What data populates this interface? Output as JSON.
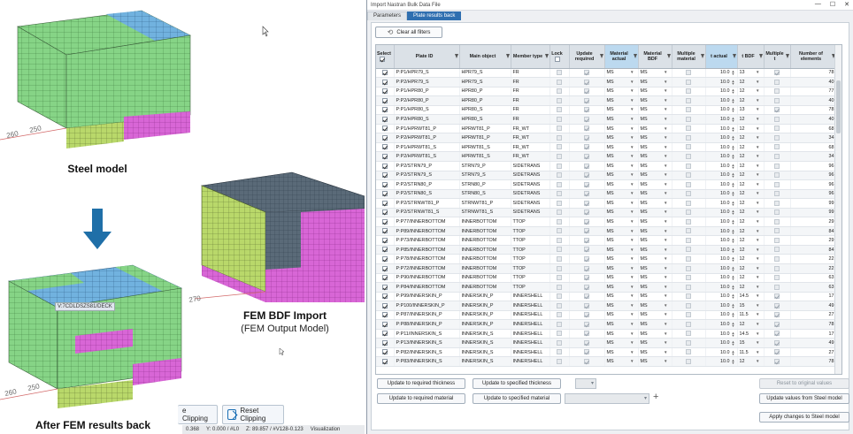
{
  "left": {
    "captions": {
      "steel": "Steel model",
      "after": "After FEM results back",
      "fem_title": "FEM BDF Import",
      "fem_sub": "(FEM Output Model)"
    },
    "tag_label": "V:7CDLDSZS81/DECK",
    "axis_ticks": [
      "260",
      "250",
      "270",
      "260",
      "250"
    ],
    "clip_button_partial": "e Clipping",
    "reset_clipping": "Reset Clipping",
    "status": [
      "0.368",
      "Y:  0.000 / #L0",
      "Z:  89.857 / #V128-0.123",
      "Visualization"
    ]
  },
  "dialog": {
    "title": "Import Nastran Bulk Data File",
    "tabs": [
      "Parameters",
      "Plate results back"
    ],
    "active_tab": 1,
    "clear_filters": "Clear all filters",
    "columns": [
      "Select",
      "Plate ID",
      "Main object",
      "Member type",
      "Lock",
      "Update required",
      "Material actual",
      "Material BDF",
      "Multiple material",
      "t actual",
      "t BDF",
      "Multiple t",
      "Number of elements"
    ],
    "rows": [
      {
        "id": "P:P1/HPR79_S",
        "main": "HPR79_S",
        "type": "FR",
        "upd": true,
        "mat": "MS",
        "matb": "MS",
        "t": "10.0",
        "tb": "13",
        "mt": true,
        "n": "78"
      },
      {
        "id": "P:P2/HPR79_S",
        "main": "HPR79_S",
        "type": "FR",
        "upd": true,
        "mat": "MS",
        "matb": "MS",
        "t": "10.0",
        "tb": "12",
        "mt": false,
        "n": "40"
      },
      {
        "id": "P:P1/HPR80_P",
        "main": "HPR80_P",
        "type": "FR",
        "upd": true,
        "mat": "MS",
        "matb": "MS",
        "t": "10.0",
        "tb": "12",
        "mt": false,
        "n": "77"
      },
      {
        "id": "P:P2/HPR80_P",
        "main": "HPR80_P",
        "type": "FR",
        "upd": true,
        "mat": "MS",
        "matb": "MS",
        "t": "10.0",
        "tb": "12",
        "mt": false,
        "n": "40"
      },
      {
        "id": "P:P1/HPR80_S",
        "main": "HPR80_S",
        "type": "FR",
        "upd": true,
        "mat": "MS",
        "matb": "MS",
        "t": "10.0",
        "tb": "13",
        "mt": true,
        "n": "78"
      },
      {
        "id": "P:P2/HPR80_S",
        "main": "HPR80_S",
        "type": "FR",
        "upd": true,
        "mat": "MS",
        "matb": "MS",
        "t": "10.0",
        "tb": "12",
        "mt": false,
        "n": "40"
      },
      {
        "id": "P:P1/HPRWT81_P",
        "main": "HPRWT81_P",
        "type": "FR_WT",
        "upd": true,
        "mat": "MS",
        "matb": "MS",
        "t": "10.0",
        "tb": "12",
        "mt": false,
        "n": "68"
      },
      {
        "id": "P:P2/HPRWT81_P",
        "main": "HPRWT81_P",
        "type": "FR_WT",
        "upd": true,
        "mat": "MS",
        "matb": "MS",
        "t": "10.0",
        "tb": "12",
        "mt": false,
        "n": "34"
      },
      {
        "id": "P:P1/HPRWT81_S",
        "main": "HPRWT81_S",
        "type": "FR_WT",
        "upd": true,
        "mat": "MS",
        "matb": "MS",
        "t": "10.0",
        "tb": "12",
        "mt": false,
        "n": "68"
      },
      {
        "id": "P:P2/HPRWT81_S",
        "main": "HPRWT81_S",
        "type": "FR_WT",
        "upd": true,
        "mat": "MS",
        "matb": "MS",
        "t": "10.0",
        "tb": "12",
        "mt": false,
        "n": "34"
      },
      {
        "id": "P:P2/STRN79_P",
        "main": "STRN79_P",
        "type": "SIDETRANS",
        "upd": true,
        "mat": "MS",
        "matb": "MS",
        "t": "10.0",
        "tb": "12",
        "mt": false,
        "n": "96"
      },
      {
        "id": "P:P2/STRN79_S",
        "main": "STRN79_S",
        "type": "SIDETRANS",
        "upd": true,
        "mat": "MS",
        "matb": "MS",
        "t": "10.0",
        "tb": "12",
        "mt": false,
        "n": "96"
      },
      {
        "id": "P:P2/STRN80_P",
        "main": "STRN80_P",
        "type": "SIDETRANS",
        "upd": true,
        "mat": "MS",
        "matb": "MS",
        "t": "10.0",
        "tb": "12",
        "mt": false,
        "n": "96"
      },
      {
        "id": "P:P2/STRN80_S",
        "main": "STRN80_S",
        "type": "SIDETRANS",
        "upd": true,
        "mat": "MS",
        "matb": "MS",
        "t": "10.0",
        "tb": "12",
        "mt": false,
        "n": "96"
      },
      {
        "id": "P:P2/STRNWT81_P",
        "main": "STRNWT81_P",
        "type": "SIDETRANS",
        "upd": true,
        "mat": "MS",
        "matb": "MS",
        "t": "10.0",
        "tb": "12",
        "mt": false,
        "n": "99"
      },
      {
        "id": "P:P2/STRNWT81_S",
        "main": "STRNWT81_S",
        "type": "SIDETRANS",
        "upd": true,
        "mat": "MS",
        "matb": "MS",
        "t": "10.0",
        "tb": "12",
        "mt": false,
        "n": "99"
      },
      {
        "id": "P:P77/INNERBOTTOM",
        "main": "INNERBOTTOM",
        "type": "TTOP",
        "upd": true,
        "mat": "MS",
        "matb": "MS",
        "t": "10.0",
        "tb": "12",
        "mt": false,
        "n": "29"
      },
      {
        "id": "P:P89/INNERBOTTOM",
        "main": "INNERBOTTOM",
        "type": "TTOP",
        "upd": true,
        "mat": "MS",
        "matb": "MS",
        "t": "10.0",
        "tb": "12",
        "mt": false,
        "n": "84"
      },
      {
        "id": "P:P73/INNERBOTTOM",
        "main": "INNERBOTTOM",
        "type": "TTOP",
        "upd": true,
        "mat": "MS",
        "matb": "MS",
        "t": "10.0",
        "tb": "12",
        "mt": false,
        "n": "29"
      },
      {
        "id": "P:P85/INNERBOTTOM",
        "main": "INNERBOTTOM",
        "type": "TTOP",
        "upd": true,
        "mat": "MS",
        "matb": "MS",
        "t": "10.0",
        "tb": "12",
        "mt": false,
        "n": "84"
      },
      {
        "id": "P:P78/INNERBOTTOM",
        "main": "INNERBOTTOM",
        "type": "TTOP",
        "upd": true,
        "mat": "MS",
        "matb": "MS",
        "t": "10.0",
        "tb": "12",
        "mt": false,
        "n": "22"
      },
      {
        "id": "P:P72/INNERBOTTOM",
        "main": "INNERBOTTOM",
        "type": "TTOP",
        "upd": true,
        "mat": "MS",
        "matb": "MS",
        "t": "10.0",
        "tb": "12",
        "mt": false,
        "n": "22"
      },
      {
        "id": "P:P90/INNERBOTTOM",
        "main": "INNERBOTTOM",
        "type": "TTOP",
        "upd": true,
        "mat": "MS",
        "matb": "MS",
        "t": "10.0",
        "tb": "12",
        "mt": false,
        "n": "63"
      },
      {
        "id": "P:P84/INNERBOTTOM",
        "main": "INNERBOTTOM",
        "type": "TTOP",
        "upd": true,
        "mat": "MS",
        "matb": "MS",
        "t": "10.0",
        "tb": "12",
        "mt": false,
        "n": "63"
      },
      {
        "id": "P:P99/INNERSKIN_P",
        "main": "INNERSKIN_P",
        "type": "INNERSHELL",
        "upd": true,
        "mat": "MS",
        "matb": "MS",
        "t": "10.0",
        "tb": "14.5",
        "mt": true,
        "n": "17"
      },
      {
        "id": "P:P100/INNERSKIN_P",
        "main": "INNERSKIN_P",
        "type": "INNERSHELL",
        "upd": true,
        "mat": "MS",
        "matb": "MS",
        "t": "10.0",
        "tb": "15",
        "mt": true,
        "n": "49"
      },
      {
        "id": "P:P87/INNERSKIN_P",
        "main": "INNERSKIN_P",
        "type": "INNERSHELL",
        "upd": true,
        "mat": "MS",
        "matb": "MS",
        "t": "10.0",
        "tb": "11.5",
        "mt": true,
        "n": "27"
      },
      {
        "id": "P:P88/INNERSKIN_P",
        "main": "INNERSKIN_P",
        "type": "INNERSHELL",
        "upd": true,
        "mat": "MS",
        "matb": "MS",
        "t": "10.0",
        "tb": "12",
        "mt": true,
        "n": "78"
      },
      {
        "id": "P:P11/INNERSKIN_S",
        "main": "INNERSKIN_S",
        "type": "INNERSHELL",
        "upd": true,
        "mat": "MS",
        "matb": "MS",
        "t": "10.0",
        "tb": "14.5",
        "mt": true,
        "n": "17"
      },
      {
        "id": "P:P13/INNERSKIN_S",
        "main": "INNERSKIN_S",
        "type": "INNERSHELL",
        "upd": true,
        "mat": "MS",
        "matb": "MS",
        "t": "10.0",
        "tb": "15",
        "mt": true,
        "n": "49"
      },
      {
        "id": "P:P82/INNERSKIN_S",
        "main": "INNERSKIN_S",
        "type": "INNERSHELL",
        "upd": true,
        "mat": "MS",
        "matb": "MS",
        "t": "10.0",
        "tb": "11.5",
        "mt": true,
        "n": "27"
      },
      {
        "id": "P:P83/INNERSKIN_S",
        "main": "INNERSKIN_S",
        "type": "INNERSHELL",
        "upd": true,
        "mat": "MS",
        "matb": "MS",
        "t": "10.0",
        "tb": "12",
        "mt": true,
        "n": "78"
      }
    ],
    "buttons": {
      "upd_req_thk": "Update to required thickness",
      "upd_spec_thk": "Update to specified thickness",
      "reset_orig": "Reset to original values",
      "upd_req_mat": "Update to required material",
      "upd_spec_mat": "Update to specified material",
      "upd_from_steel": "Update values from Steel model",
      "apply_steel": "Apply changes to Steel model"
    }
  },
  "colors": {
    "accent": "#2f6fb0",
    "header_highlight": "#bcd9ef",
    "model_green": "#7fcf7a",
    "model_blue": "#6aa9d8",
    "model_magenta": "#d35fd0",
    "arrow_blue": "#1f6fa8"
  }
}
